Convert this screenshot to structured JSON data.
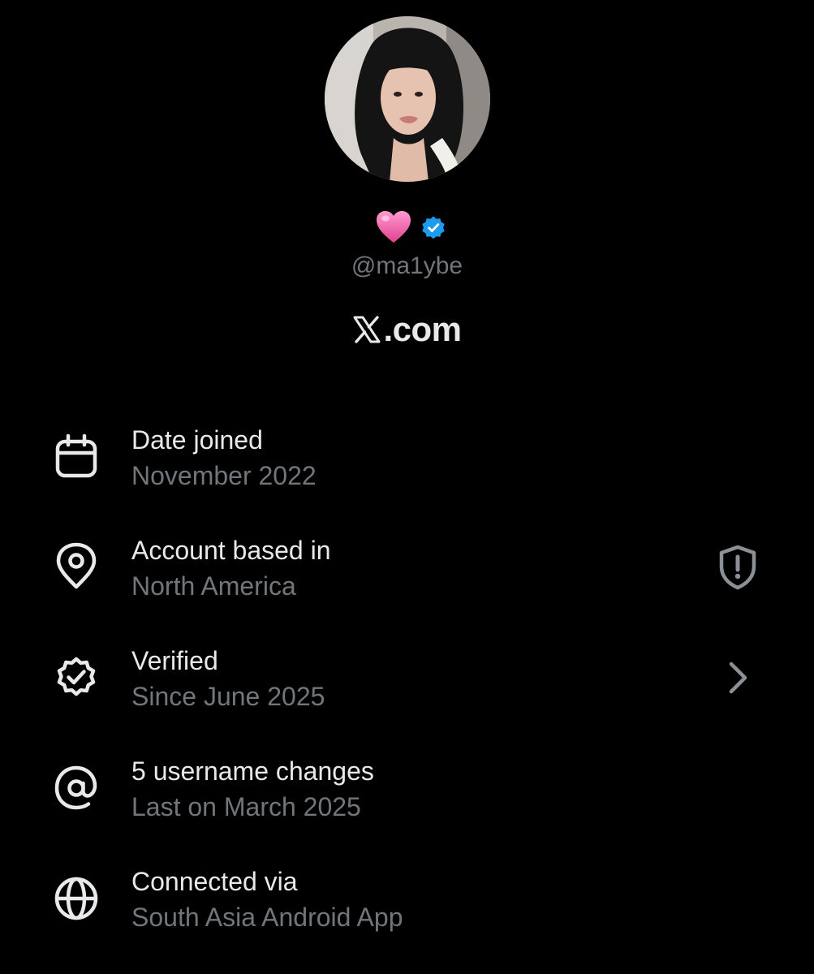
{
  "profile": {
    "handle": "@ma1ybe",
    "badges": {
      "emoji": "pink-heart-icon",
      "verified": "verified-badge-icon",
      "verified_color": "#1d9bf0"
    },
    "brand": "X.com"
  },
  "colors": {
    "background": "#000000",
    "primary_text": "#e7e9ea",
    "secondary_text": "#71767b"
  },
  "about": [
    {
      "icon": "calendar-icon",
      "title": "Date joined",
      "subtitle": "November 2022"
    },
    {
      "icon": "location-pin-icon",
      "title": "Account based in",
      "subtitle": "North America",
      "trailing_icon": "shield-alert-icon"
    },
    {
      "icon": "verified-outline-icon",
      "title": "Verified",
      "subtitle": "Since June 2025",
      "trailing_icon": "chevron-right-icon"
    },
    {
      "icon": "at-sign-icon",
      "title": "5 username changes",
      "subtitle": "Last on March 2025"
    },
    {
      "icon": "globe-icon",
      "title": "Connected via",
      "subtitle": "South Asia Android App"
    }
  ]
}
